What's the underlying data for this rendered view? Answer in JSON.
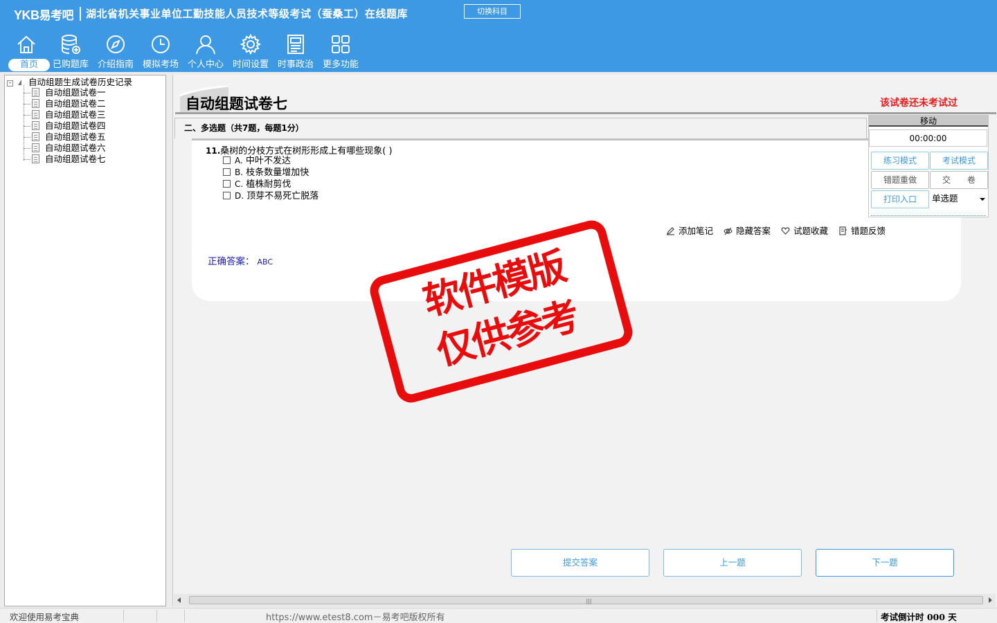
{
  "header": {
    "brand_latin": "YKB",
    "brand_cn": "易考吧",
    "title": "湖北省机关事业单位工勤技能人员技术等级考试（蚕桑工）在线题库",
    "switch_button": "切换科目"
  },
  "nav": [
    {
      "label": "首页",
      "icon": "home-icon",
      "active": true
    },
    {
      "label": "已购题库",
      "icon": "database-icon"
    },
    {
      "label": "介绍指南",
      "icon": "compass-icon"
    },
    {
      "label": "模拟考场",
      "icon": "clock-icon"
    },
    {
      "label": "个人中心",
      "icon": "user-icon"
    },
    {
      "label": "时间设置",
      "icon": "gear-icon"
    },
    {
      "label": "时事政治",
      "icon": "newspaper-icon"
    },
    {
      "label": "更多功能",
      "icon": "grid-icon"
    }
  ],
  "tree": {
    "root": "自动组题生成试卷历史记录",
    "items": [
      "自动组题试卷一",
      "自动组题试卷二",
      "自动组题试卷三",
      "自动组题试卷四",
      "自动组题试卷五",
      "自动组题试卷六",
      "自动组题试卷七"
    ]
  },
  "main": {
    "paper_title": "自动组题试卷七",
    "status_note": "该试卷还未考试过",
    "section_header": "二、多选题（共7题，每题1分）",
    "question": {
      "number": "11.",
      "text": "桑树的分枝方式在树形形成上有哪些现象( )",
      "options": [
        {
          "key": "A.",
          "text": "中叶不发达"
        },
        {
          "key": "B.",
          "text": "枝条数量增加快"
        },
        {
          "key": "C.",
          "text": "植株耐剪伐"
        },
        {
          "key": "D.",
          "text": "顶芽不易死亡脱落"
        }
      ],
      "answer_label": "正确答案：",
      "answer_value": "ABC"
    },
    "tools": [
      "添加笔记",
      "隐藏答案",
      "试题收藏",
      "错题反馈"
    ],
    "buttons": {
      "submit": "提交答案",
      "prev": "上一题",
      "next": "下一题"
    }
  },
  "panel": {
    "move": "移动",
    "timer": "00:00:00",
    "practice_mode": "练习模式",
    "exam_mode": "考试模式",
    "redo_wrong": "错题重做",
    "hand_in": "交　　卷",
    "print": "打印入口",
    "question_type": "单选题"
  },
  "stamp": {
    "line1": "软件模版",
    "line2": "仅供参考"
  },
  "statusbar": {
    "welcome": "欢迎使用易考宝典",
    "url": "https://www.etest8.com－易考吧版权所有",
    "countdown": "考试倒计时 000 天"
  },
  "colors": {
    "accent": "#3d99e3",
    "alert": "#e81c1c",
    "stamp": "#e80c0c",
    "answer": "#1d1da8"
  }
}
